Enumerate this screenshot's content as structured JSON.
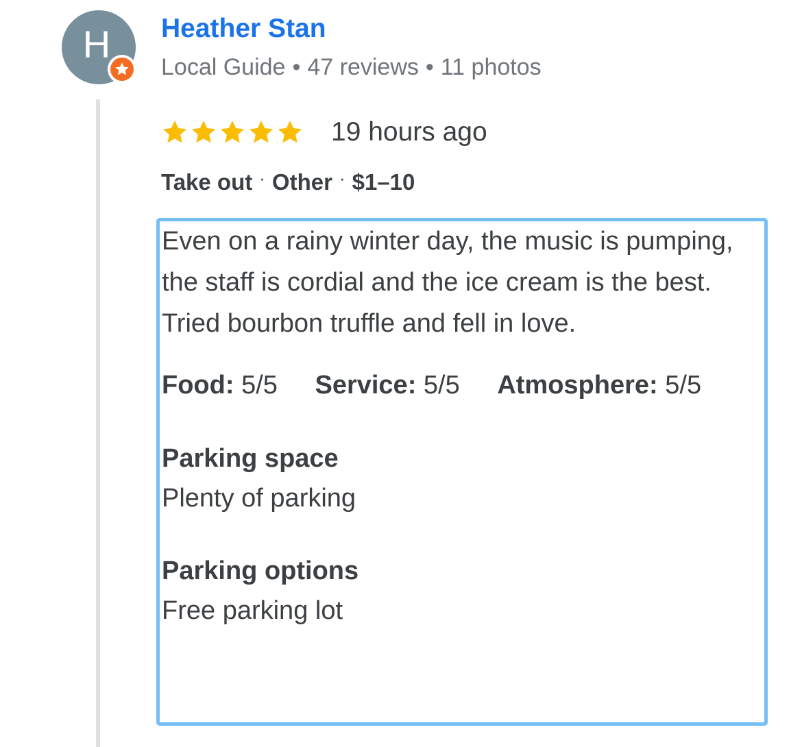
{
  "reviewer": {
    "initial": "H",
    "name": "Heather Stan",
    "meta": {
      "role": "Local Guide",
      "reviews": "47 reviews",
      "photos": "11 photos",
      "separator": "•"
    },
    "badge_icon": "local-guide-star-badge"
  },
  "review": {
    "stars": 5,
    "star_color": "#fbbc04",
    "time_ago": "19 hours ago",
    "tags": [
      "Take out",
      "Other",
      "$1–10"
    ],
    "tag_separator": "·",
    "text": "Even on a rainy winter day, the music is pumping, the staff is cordial and the ice cream is the best. Tried bourbon truffle and fell in love.",
    "ratings": [
      {
        "label": "Food:",
        "value": "5/5"
      },
      {
        "label": "Service:",
        "value": "5/5"
      },
      {
        "label": "Atmosphere:",
        "value": "5/5"
      }
    ],
    "attributes": [
      {
        "label": "Parking space",
        "value": "Plenty of parking"
      },
      {
        "label": "Parking options",
        "value": "Free parking lot"
      }
    ]
  },
  "colors": {
    "name_link": "#1a73e8",
    "avatar_bg": "#78909c",
    "badge": "#f26d21",
    "highlight_border": "#74bff6"
  }
}
